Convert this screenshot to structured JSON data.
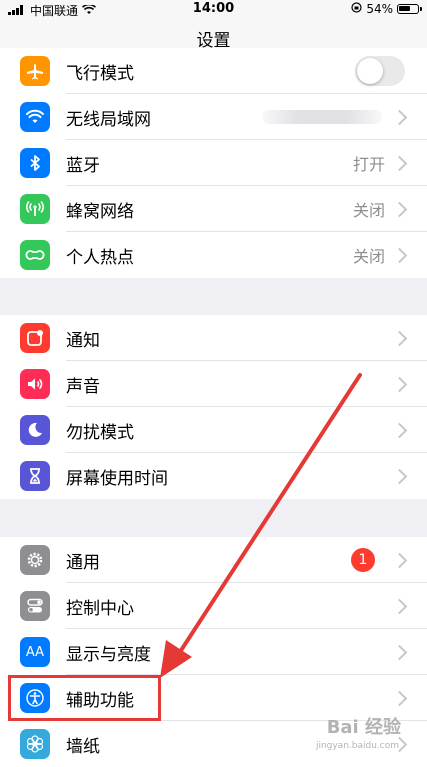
{
  "status_bar": {
    "carrier": "中国联通",
    "time": "14:00",
    "battery": "54%"
  },
  "nav": {
    "title": "设置"
  },
  "groups": [
    {
      "rows": [
        {
          "label": "飞行模式",
          "icon": "airplane-icon",
          "color": "#ff9500",
          "control": "toggle-off"
        },
        {
          "label": "无线局域网",
          "icon": "wifi-icon",
          "color": "#007aff",
          "value": ""
        },
        {
          "label": "蓝牙",
          "icon": "bluetooth-icon",
          "color": "#007aff",
          "value": "打开"
        },
        {
          "label": "蜂窝网络",
          "icon": "cellular-icon",
          "color": "#34c759",
          "value": "关闭"
        },
        {
          "label": "个人热点",
          "icon": "hotspot-icon",
          "color": "#34c759",
          "value": "关闭"
        }
      ]
    },
    {
      "rows": [
        {
          "label": "通知",
          "icon": "notification-icon",
          "color": "#ff3b30"
        },
        {
          "label": "声音",
          "icon": "speaker-icon",
          "color": "#ff2d55"
        },
        {
          "label": "勿扰模式",
          "icon": "moon-icon",
          "color": "#5856d6"
        },
        {
          "label": "屏幕使用时间",
          "icon": "hourglass-icon",
          "color": "#5856d6"
        }
      ]
    },
    {
      "rows": [
        {
          "label": "通用",
          "icon": "gear-icon",
          "color": "#8e8e93",
          "badge": "1"
        },
        {
          "label": "控制中心",
          "icon": "switches-icon",
          "color": "#8e8e93"
        },
        {
          "label": "显示与亮度",
          "icon": "aa-icon",
          "color": "#007aff"
        },
        {
          "label": "辅助功能",
          "icon": "accessibility-icon",
          "color": "#007aff"
        },
        {
          "label": "墙纸",
          "icon": "wallpaper-icon",
          "color": "#34aadc"
        }
      ]
    }
  ],
  "icons_text": {
    "aa": "AA"
  },
  "watermark": {
    "text": "Bai 经验",
    "sub": "jingyan.baidu.com"
  }
}
